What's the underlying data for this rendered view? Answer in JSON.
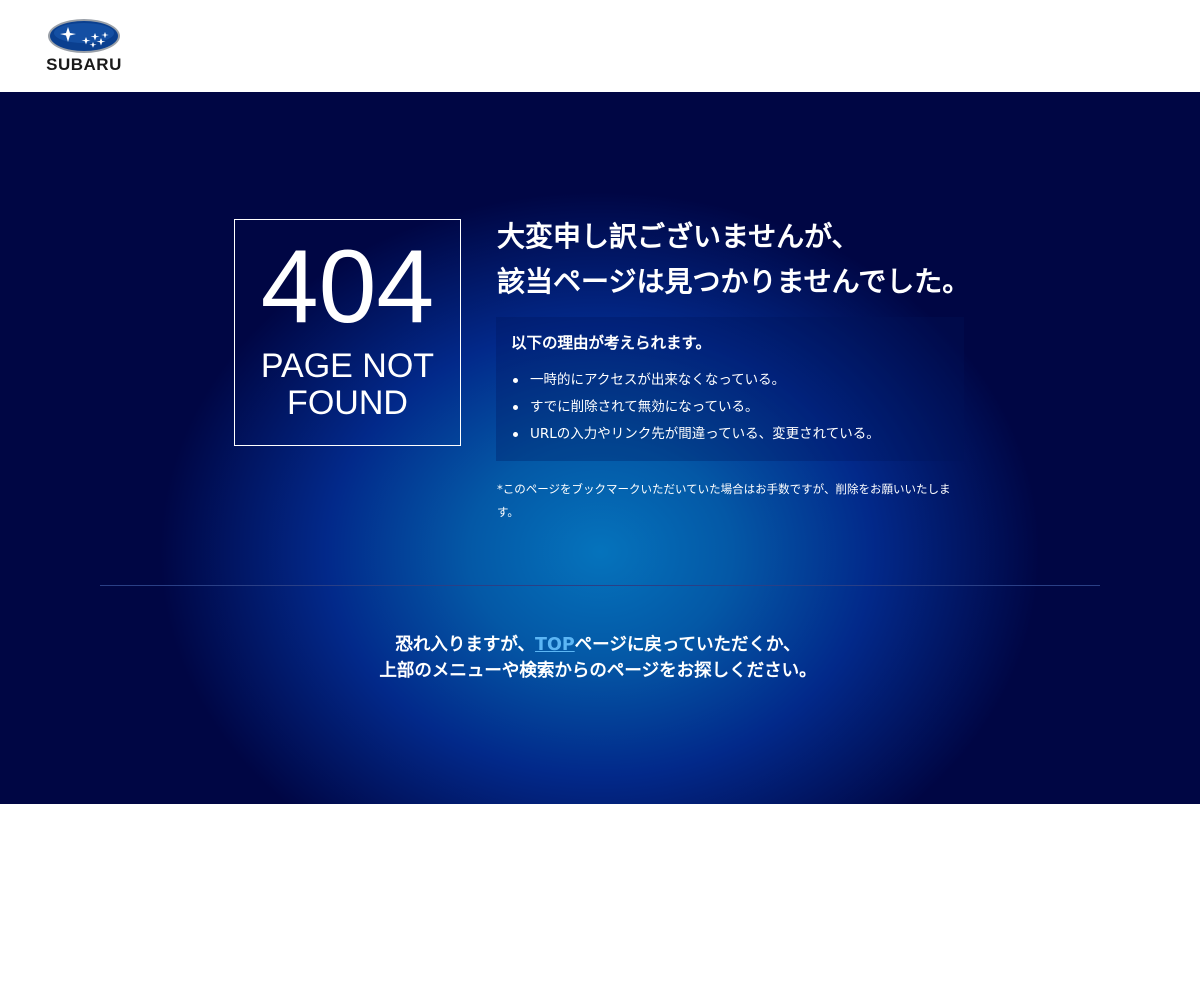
{
  "header": {
    "logo_text": "SUBARU",
    "logo_icon": "subaru-pleiades-logo"
  },
  "error": {
    "code": "404",
    "label": "PAGE NOT FOUND"
  },
  "headline": {
    "line1": "大変申し訳ございませんが、",
    "line2": "該当ページは見つかりませんでした。"
  },
  "reasons": {
    "title": "以下の理由が考えられます。",
    "items": [
      "一時的にアクセスが出来なくなっている。",
      "すでに削除されて無効になっている。",
      "URLの入力やリンク先が間違っている、変更されている。"
    ]
  },
  "note": "*このページをブックマークいただいていた場合はお手数ですが、削除をお願いいたします。",
  "bottom": {
    "line1_before": "恐れ入りますが、",
    "top_link": "TOP",
    "line1_after": "ページに戻っていただくか、",
    "line2": "上部のメニューや検索からのページをお探しください。"
  },
  "colors": {
    "link": "#5cb6f5",
    "hero_center": "#0573bc",
    "hero_edge": "#000644",
    "logo_blue": "#0a3f8f"
  }
}
